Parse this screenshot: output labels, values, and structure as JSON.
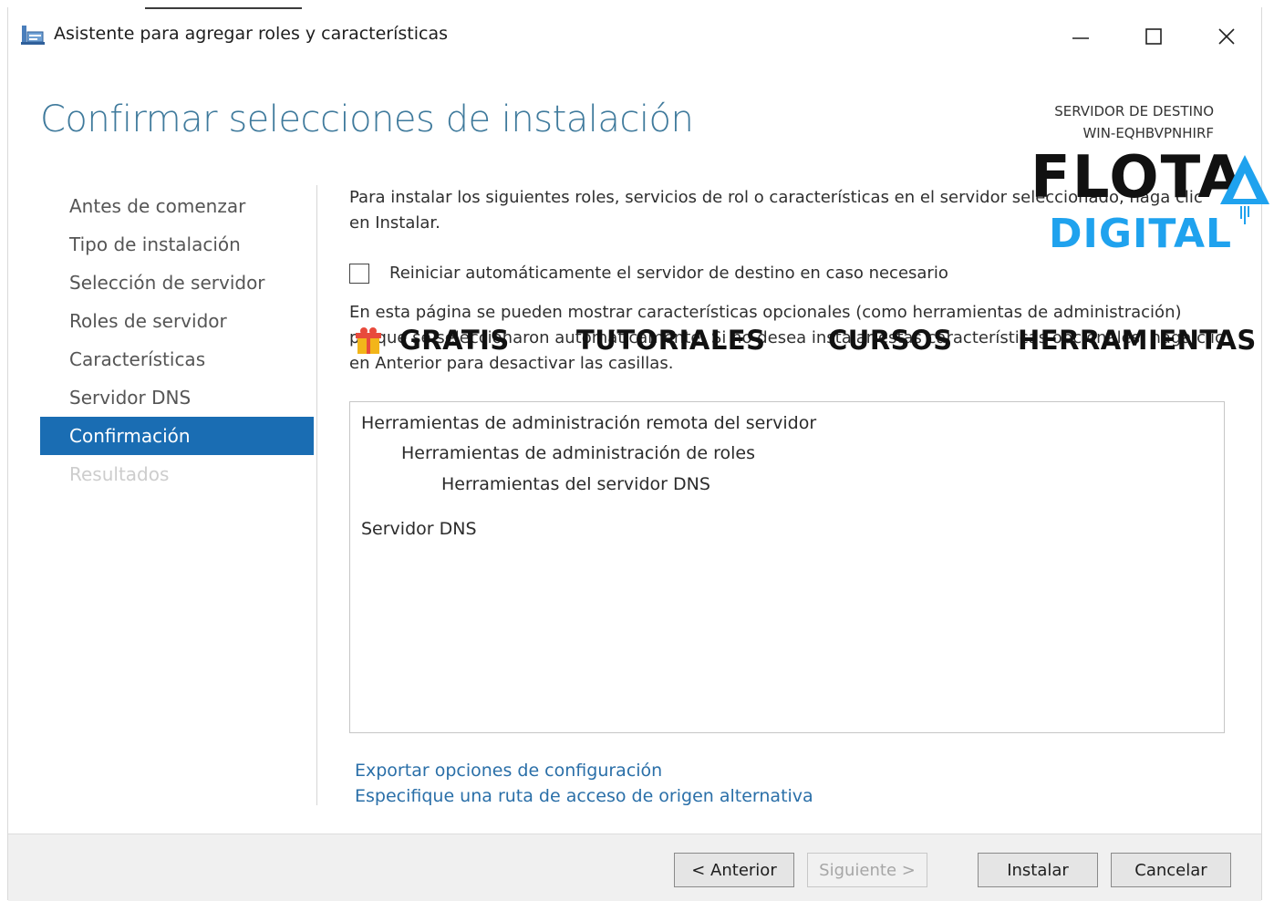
{
  "window": {
    "title": "Asistente para agregar roles y características",
    "controls": {
      "minimize": "minimize-icon",
      "maximize": "maximize-icon",
      "close": "close-icon"
    }
  },
  "header": {
    "page_title": "Confirmar selecciones de instalación",
    "dest_label": "SERVIDOR DE DESTINO",
    "dest_server": "WIN-EQHBVPNHIRF"
  },
  "nav": {
    "items": [
      {
        "label": "Antes de comenzar",
        "state": "normal"
      },
      {
        "label": "Tipo de instalación",
        "state": "normal"
      },
      {
        "label": "Selección de servidor",
        "state": "normal"
      },
      {
        "label": "Roles de servidor",
        "state": "normal"
      },
      {
        "label": "Características",
        "state": "normal"
      },
      {
        "label": "Servidor DNS",
        "state": "normal"
      },
      {
        "label": "Confirmación",
        "state": "active"
      },
      {
        "label": "Resultados",
        "state": "disabled"
      }
    ]
  },
  "content": {
    "intro_line1": "Para instalar los siguientes roles, servicios de rol o características en el servidor seleccionado, haga clic",
    "intro_line2": "en Instalar.",
    "restart_checkbox_label": "Reiniciar automáticamente el servidor de destino en caso necesario",
    "restart_checked": false,
    "optional_line1": "En esta página se pueden mostrar características opcionales (como herramientas de administración)",
    "optional_line2": "porque se seleccionaron automáticamente. Si no desea instalar estas características opcionales, haga clic",
    "optional_line3": "en Anterior para desactivar las casillas.",
    "selections": [
      {
        "label": "Herramientas de administración remota del servidor",
        "level": 0
      },
      {
        "label": "Herramientas de administración de roles",
        "level": 1
      },
      {
        "label": "Herramientas del servidor DNS",
        "level": 2
      },
      {
        "label": "Servidor DNS",
        "level": 0
      }
    ],
    "links": {
      "export": "Exportar opciones de configuración",
      "alt_source": "Especifique una ruta de acceso de origen alternativa"
    }
  },
  "footer": {
    "back": "< Anterior",
    "next": "Siguiente >",
    "install": "Instalar",
    "cancel": "Cancelar"
  },
  "watermark": {
    "logo_line1": "FLOTA",
    "logo_line2": "DIGITAL",
    "bar": [
      "GRATIS",
      "TUTORIALES",
      "CURSOS",
      "HERRAMIENTAS"
    ],
    "colors": {
      "logo_dark": "#111111",
      "logo_blue": "#1fa2ee",
      "gift": "#f2b51a"
    }
  },
  "colors": {
    "accent": "#1a6db3",
    "title": "#3f7a9c",
    "link": "#2a6fa8"
  }
}
